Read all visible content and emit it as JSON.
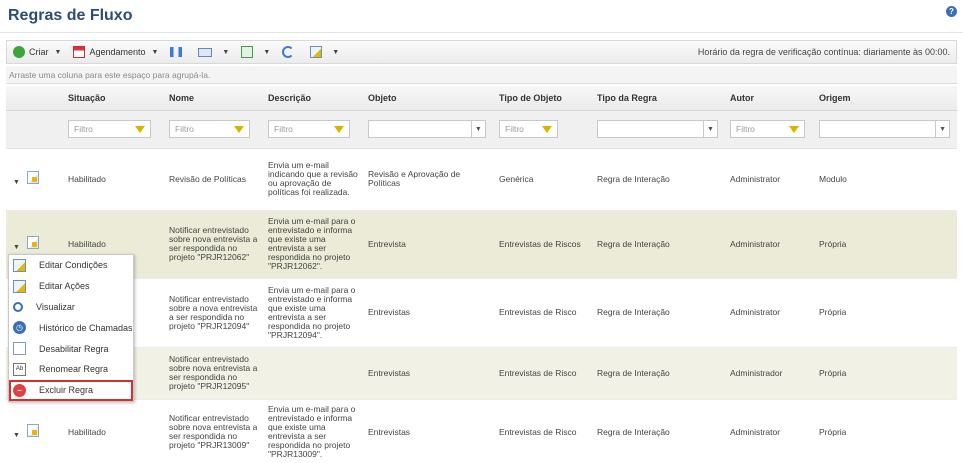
{
  "page": {
    "title": "Regras de Fluxo",
    "help_icon": "?"
  },
  "toolbar": {
    "criar_label": "Criar",
    "agendamento_label": "Agendamento",
    "check_time": "Horário da regra de verificação contínua: diariamente às 00:00."
  },
  "group_hint": "Arraste uma coluna para este espaço para agrupá-la.",
  "columns": [
    "Situação",
    "Nome",
    "Descrição",
    "Objeto",
    "Tipo de Objeto",
    "Tipo da Regra",
    "Autor",
    "Origem"
  ],
  "filter_placeholder": "Filtro",
  "rows": [
    {
      "situacao": "Habilitado",
      "nome": "Revisão de Políticas",
      "descricao": "Envia um e-mail indicando que a revisão ou aprovação de políticas foi realizada.",
      "objeto": "Revisão e Aprovação de Políticas",
      "tipo_objeto": "Genérica",
      "tipo_regra": "Regra de Interação",
      "autor": "Administrator",
      "origem": "Modulo"
    },
    {
      "situacao": "Habilitado",
      "nome": "Notificar entrevistado sobre nova entrevista a ser respondida no projeto \"PRJR12062\"",
      "descricao": "Envia um e-mail para o entrevistado e informa que existe uma entrevista a ser respondida no projeto \"PRJR12062\".",
      "objeto": "Entrevista",
      "tipo_objeto": "Entrevistas de Riscos",
      "tipo_regra": "Regra de Interação",
      "autor": "Administrator",
      "origem": "Própria"
    },
    {
      "situacao": "",
      "nome": "Notificar entrevistado sobre a nova entrevista a ser respondida no projeto \"PRJR12094\"",
      "descricao": "Envia um e-mail para o entrevistado e informa que existe uma entrevista a ser respondida no projeto \"PRJR12094\".",
      "objeto": "Entrevistas",
      "tipo_objeto": "Entrevistas de Risco",
      "tipo_regra": "Regra de Interação",
      "autor": "Administrator",
      "origem": "Própria"
    },
    {
      "situacao": "",
      "nome": "Notificar entrevistado sobre nova entrevista a ser respondida no projeto \"PRJR12095\"",
      "descricao": "",
      "objeto": "Entrevistas",
      "tipo_objeto": "Entrevistas de Risco",
      "tipo_regra": "Regra de Interação",
      "autor": "Administrador",
      "origem": "Própria"
    },
    {
      "situacao": "Habilitado",
      "nome": "Notificar entrevistado sobre nova entrevista a ser respondida no projeto \"PRJR13009\"",
      "descricao": "Envia um e-mail para o entrevistado e informa que existe uma entrevista a ser respondida no projeto \"PRJR13009\".",
      "objeto": "Entrevistas",
      "tipo_objeto": "Entrevistas de Risco",
      "tipo_regra": "Regra de Interação",
      "autor": "Administrator",
      "origem": "Própria"
    }
  ],
  "context_menu": [
    {
      "label": "Editar Condições",
      "icon": "edit-conditions-icon"
    },
    {
      "label": "Editar Ações",
      "icon": "edit-actions-icon"
    },
    {
      "label": "Visualizar",
      "icon": "view-icon"
    },
    {
      "label": "Histórico de Chamadas",
      "icon": "history-icon"
    },
    {
      "label": "Desabilitar Regra",
      "icon": "disable-icon"
    },
    {
      "label": "Renomear Regra",
      "icon": "rename-icon"
    },
    {
      "label": "Excluir Regra",
      "icon": "delete-icon"
    }
  ],
  "colors": {
    "title": "#2b4c74",
    "highlight": "#d32f2f",
    "row_alt": "#f1f1e6"
  }
}
